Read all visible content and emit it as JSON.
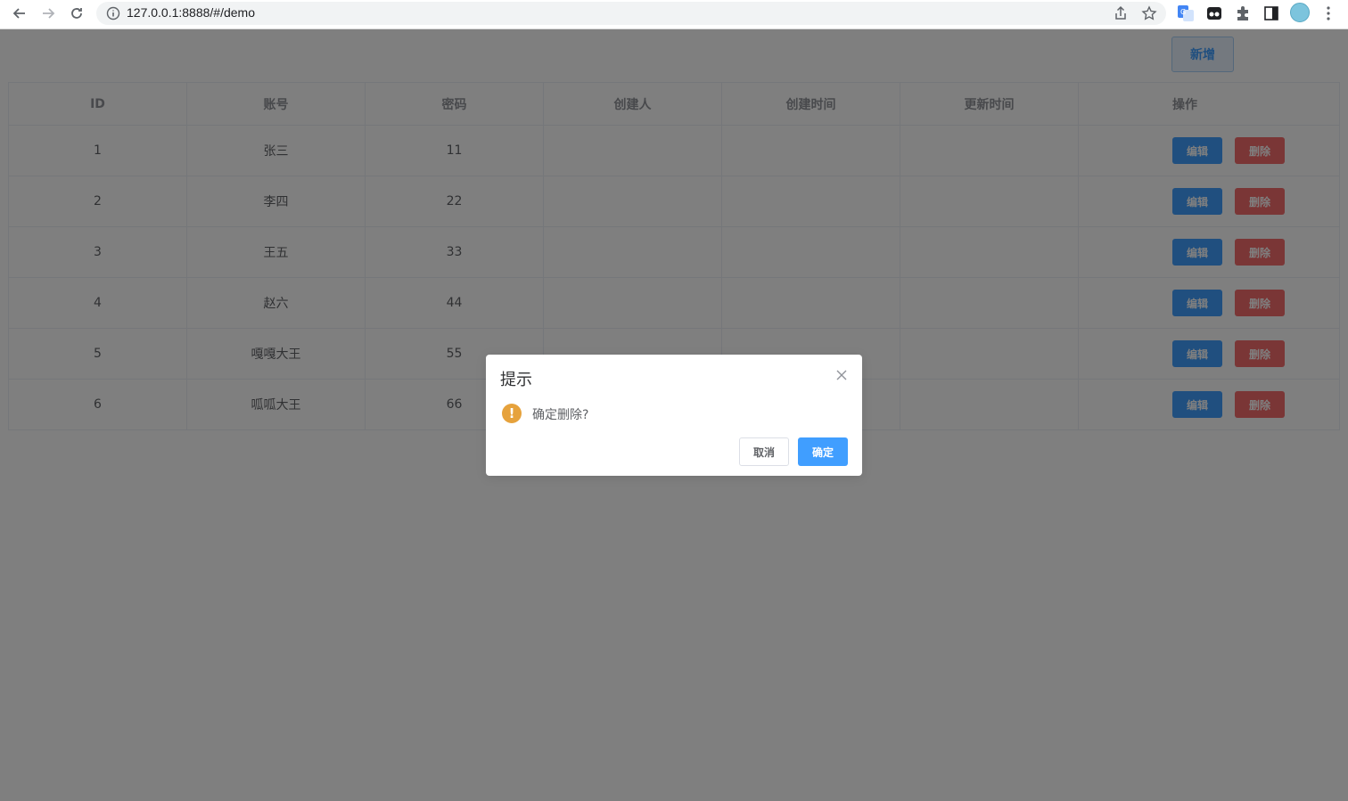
{
  "browser": {
    "url": "127.0.0.1:8888/#/demo"
  },
  "toolbar": {
    "add_label": "新增"
  },
  "table": {
    "headers": [
      "ID",
      "账号",
      "密码",
      "创建人",
      "创建时间",
      "更新时间",
      "操作"
    ],
    "rows": [
      {
        "id": "1",
        "account": "张三",
        "password": "11",
        "creator": "",
        "created": "",
        "updated": ""
      },
      {
        "id": "2",
        "account": "李四",
        "password": "22",
        "creator": "",
        "created": "",
        "updated": ""
      },
      {
        "id": "3",
        "account": "王五",
        "password": "33",
        "creator": "",
        "created": "",
        "updated": ""
      },
      {
        "id": "4",
        "account": "赵六",
        "password": "44",
        "creator": "",
        "created": "",
        "updated": ""
      },
      {
        "id": "5",
        "account": "嘎嘎大王",
        "password": "55",
        "creator": "",
        "created": "",
        "updated": ""
      },
      {
        "id": "6",
        "account": "呱呱大王",
        "password": "66",
        "creator": "",
        "created": "",
        "updated": ""
      }
    ],
    "edit_label": "编辑",
    "delete_label": "删除"
  },
  "dialog": {
    "title": "提示",
    "message": "确定删除?",
    "cancel_label": "取消",
    "confirm_label": "确定"
  },
  "colors": {
    "primary": "#409eff",
    "danger": "#f56c6c",
    "warning": "#e6a23c",
    "overlay": "rgba(0,0,0,0.5)"
  }
}
